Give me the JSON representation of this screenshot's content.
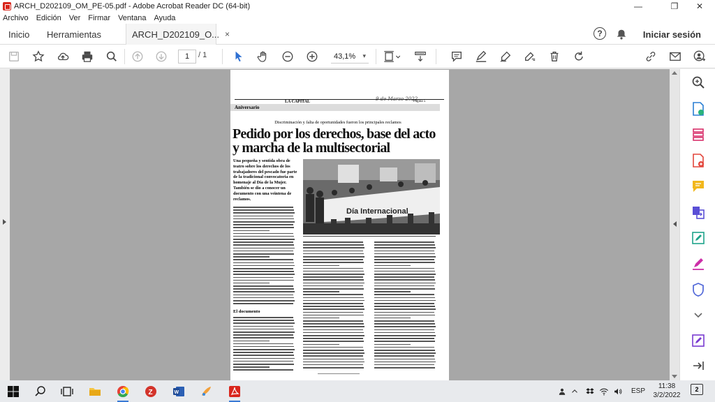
{
  "window": {
    "title": "ARCH_D202109_OM_PE-05.pdf - Adobe Acrobat Reader DC (64-bit)",
    "minimize": "—",
    "restore": "❐",
    "close": "✕"
  },
  "menu": [
    "Archivo",
    "Edición",
    "Ver",
    "Firmar",
    "Ventana",
    "Ayuda"
  ],
  "tabs": {
    "home": "Inicio",
    "tools": "Herramientas",
    "document": "ARCH_D202109_O...",
    "close": "×"
  },
  "account": {
    "help": "?",
    "signin": "Iniciar sesión"
  },
  "toolbar": {
    "page_current": "1",
    "page_total": "/  1",
    "zoom": "43,1%",
    "zoom_caret": "▾"
  },
  "newspaper": {
    "paper_name": "LA CAPITAL",
    "handwritten_date": "9 de Marzo 2022",
    "page_label": "Página 5",
    "section": "Aniversario",
    "kicker": "Discriminación y falta de oportunidades fueron los principales reclamos",
    "title": "Pedido por los derechos, base del acto y marcha de la multisectorial",
    "lead": "Una pequeña y sentida obra de teatro sobre los derechos de los trabajadores del pescado fue parte de la tradicional convocatoria en homenaje al Día de la Mujer. También se dio a conocer un documento con una veintena de reclamos.",
    "banner": "Día Internacional",
    "subhead": "El documento"
  },
  "taskbar": {
    "language": "ESP",
    "time": "11:38",
    "date": "3/2/2022",
    "notifications": "2"
  }
}
